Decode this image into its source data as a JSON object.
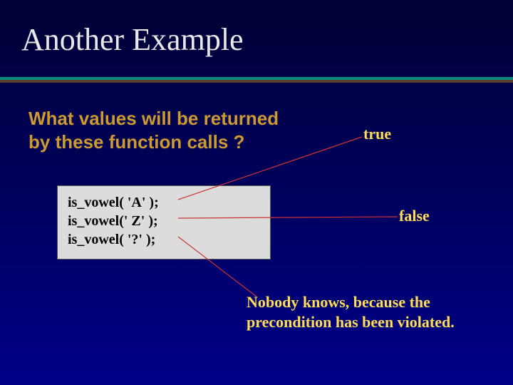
{
  "title": "Another Example",
  "question_line1": "What values will be returned",
  "question_line2": "by these function calls ?",
  "code": {
    "line1": "is_vowel( 'A' );",
    "line2": "is_vowel(' Z' );",
    "line3": "is_vowel( '?' );"
  },
  "answers": {
    "true": "true",
    "false": "false"
  },
  "footnote_line1": "Nobody knows, because the",
  "footnote_line2": "precondition has been violated.",
  "colors": {
    "accent": "#ffdd55",
    "question": "#cc9933",
    "rule_top": "#0a8a7a",
    "rule_bottom": "#5c4030"
  }
}
